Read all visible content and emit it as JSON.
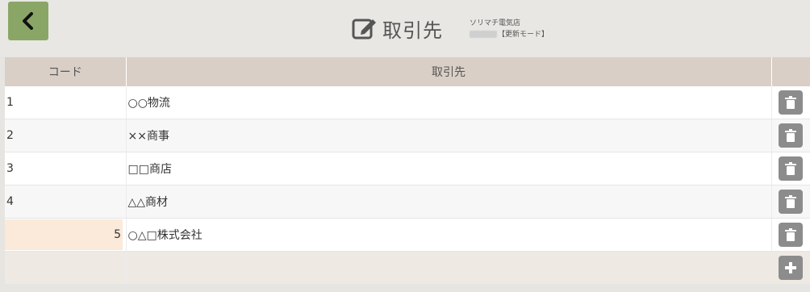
{
  "header": {
    "title": "取引先",
    "shop_name": "ソリマチ電気店",
    "mode": "【更新モード】"
  },
  "table": {
    "columns": [
      "コード",
      "取引先",
      ""
    ],
    "rows": [
      {
        "code": "1",
        "name": "○○物流"
      },
      {
        "code": "2",
        "name": "××商事"
      },
      {
        "code": "3",
        "name": "□□商店"
      },
      {
        "code": "4",
        "name": "△△商材"
      }
    ],
    "editing_row": {
      "code": "5",
      "name": "○△□株式会社"
    }
  },
  "icons": {
    "back": "chevron-left-icon",
    "title": "edit-icon",
    "delete": "trash-icon",
    "add": "plus-icon"
  },
  "colors": {
    "back_button": "#8aa667",
    "header_row": "#d9cfc6",
    "editing_field": "#fbe9d9",
    "action_button": "#8c8c8c"
  }
}
